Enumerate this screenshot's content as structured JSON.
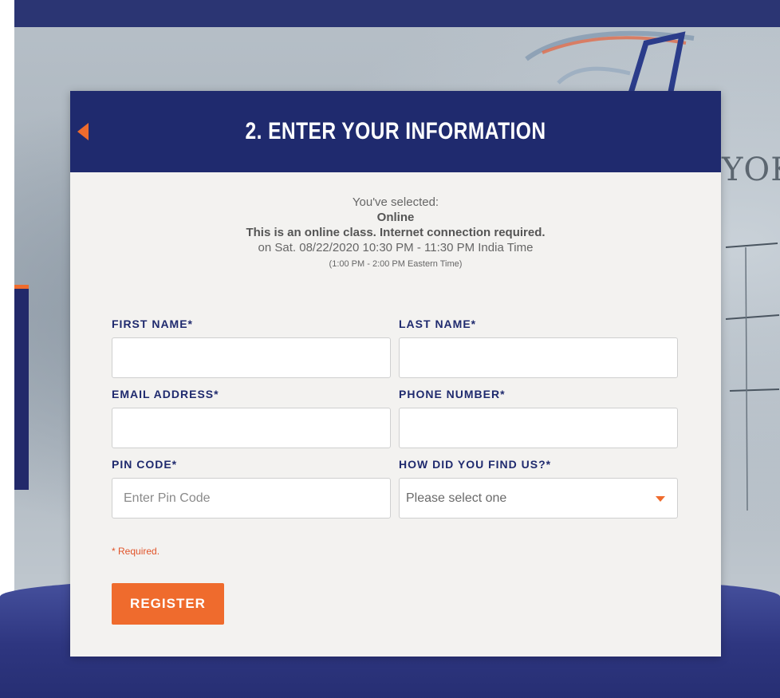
{
  "colors": {
    "navy": "#1f2a6e",
    "orange": "#ef6b2d",
    "card_bg": "#f3f2f0"
  },
  "background": {
    "handwriting": "YOK"
  },
  "header": {
    "back_icon": "back-arrow-icon",
    "title": "2. ENTER YOUR INFORMATION"
  },
  "selection": {
    "label": "You've selected:",
    "name": "Online",
    "description": "This is an online class. Internet connection required.",
    "datetime": "on Sat. 08/22/2020 10:30 PM - 11:30 PM India Time",
    "eastern_time": "(1:00 PM - 2:00 PM Eastern Time)"
  },
  "form": {
    "first_name": {
      "label": "FIRST NAME*",
      "value": "",
      "placeholder": ""
    },
    "last_name": {
      "label": "LAST NAME*",
      "value": "",
      "placeholder": ""
    },
    "email": {
      "label": "EMAIL ADDRESS*",
      "value": "",
      "placeholder": ""
    },
    "phone": {
      "label": "PHONE NUMBER*",
      "value": "",
      "placeholder": ""
    },
    "pin_code": {
      "label": "PIN CODE*",
      "value": "",
      "placeholder": "Enter Pin Code"
    },
    "find_us": {
      "label": "HOW DID YOU FIND US?*",
      "selected": "Please select one",
      "caret_icon": "caret-down-icon"
    },
    "required_note": "* Required.",
    "submit_label": "REGISTER"
  }
}
